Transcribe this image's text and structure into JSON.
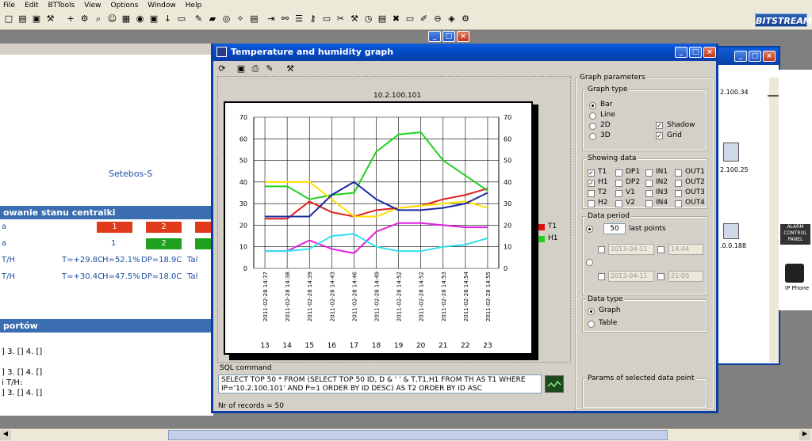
{
  "menu": [
    "File",
    "Edit",
    "BTTools",
    "View",
    "Options",
    "Window",
    "Help"
  ],
  "brand": "BITSTREAM",
  "toolbar_icons": [
    "new-icon",
    "open-icon",
    "save-icon",
    "tools-icon",
    "add-icon",
    "binoculars-icon",
    "search-icon",
    "people-icon",
    "table-icon",
    "chart-icon",
    "floppy-icon",
    "arrow-icon",
    "note-icon",
    "pencil-icon",
    "folder-icon",
    "globe-icon",
    "star-icon",
    "calc-icon",
    "exit-icon",
    "network-icon",
    "book-icon",
    "key-icon",
    "folder2-icon",
    "scissors-icon",
    "wrench-icon",
    "clock-icon",
    "list-icon",
    "x-icon",
    "card-icon",
    "pen-icon",
    "stop-icon",
    "warning-icon",
    "gear-icon"
  ],
  "background": {
    "device_name": "Setebos-S",
    "section1": "owanie stanu centralki",
    "row1": {
      "label": "a",
      "v1": "1",
      "v2": "2"
    },
    "row2": {
      "label": "a",
      "v1": "1",
      "v2": "2"
    },
    "row3": {
      "label": "T/H",
      "t": "T=+29.8C",
      "h": "H=52.1%",
      "dp": "DP=18.9C",
      "x": "Tal"
    },
    "row4": {
      "label": "T/H",
      "t": "T=+30.4C",
      "h": "H=47.5%",
      "dp": "DP=18.0C",
      "x": "Tal"
    },
    "section2": "portów",
    "line1": "] 3. [] 4. []",
    "line2": "] 3. [] 4. []",
    "line3": "i T/H:",
    "line4": "] 3. [] 4. []"
  },
  "right_devices": [
    "2.100.34",
    "2.100.25",
    ".0.0.188",
    "ALARM CONTROL PANEL",
    "IP Phone"
  ],
  "graph_window": {
    "title": "Temperature and humidity graph",
    "chart_title": "10.2.100.101",
    "sql_label": "SQL command",
    "sql": "SELECT TOP 50 * FROM (SELECT TOP 50 ID, D & ' ' & T,T1,H1 FROM TH AS T1 WHERE IP='10.2.100.101' AND P=1 ORDER BY ID DESC) AS T2 ORDER BY ID ASC",
    "records": "Nr of records = 50",
    "params": {
      "title": "Graph parameters",
      "graph_type": "Graph type",
      "bar": "Bar",
      "line": "Line",
      "d2": "2D",
      "d3": "3D",
      "shadow": "Shadow",
      "grid": "Grid",
      "showing": "Showing data",
      "checks": [
        [
          "T1",
          "DP1",
          "IN1",
          "OUT1"
        ],
        [
          "H1",
          "DP2",
          "IN2",
          "OUT2"
        ],
        [
          "T2",
          "V1",
          "IN3",
          "OUT3"
        ],
        [
          "H2",
          "V2",
          "IN4",
          "OUT4"
        ]
      ],
      "period": "Data period",
      "points_value": "50",
      "points_label": "last points",
      "date1": "2013-04-11",
      "time1": "14:44",
      "date2": "2013-04-11",
      "time2": "21:00",
      "data_type": "Data type",
      "graph": "Graph",
      "table": "Table",
      "selected": "Params of selected data point"
    }
  },
  "chart_data": {
    "type": "line",
    "title": "10.2.100.101",
    "x": [
      "2011-02-28 14:37",
      "2011-02-28 14:38",
      "2011-02-28 14:39",
      "2011-02-28 14:43",
      "2011-02-28 14:46",
      "2011-02-28 14:49",
      "2011-02-28 14:52",
      "2011-02-28 14:52",
      "2011-02-28 14:53",
      "2011-02-28 14:54",
      "2011-02-28 14:55"
    ],
    "indices": [
      13,
      14,
      15,
      16,
      17,
      18,
      19,
      20,
      21,
      22,
      23
    ],
    "ylim": [
      0,
      70
    ],
    "yticks": [
      0,
      10,
      20,
      30,
      40,
      50,
      60,
      70
    ],
    "grid": true,
    "legend": [
      {
        "name": "T1",
        "color": "#e01010"
      },
      {
        "name": "H1",
        "color": "#20d020"
      }
    ],
    "series": [
      {
        "color": "#e02020",
        "values": [
          23,
          23,
          31,
          26,
          24,
          27,
          28,
          29,
          32,
          34,
          37
        ]
      },
      {
        "color": "#20d020",
        "values": [
          38,
          38,
          32,
          34,
          35,
          54,
          62,
          63,
          50,
          43,
          36
        ]
      },
      {
        "color": "#ffe000",
        "values": [
          40,
          40,
          40,
          32,
          24,
          24,
          28,
          29,
          30,
          31,
          28
        ]
      },
      {
        "color": "#1a2aa0",
        "values": [
          24,
          24,
          24,
          34,
          40,
          32,
          27,
          27,
          28,
          30,
          35
        ]
      },
      {
        "color": "#e020e0",
        "values": [
          8,
          8,
          13,
          9,
          7,
          17,
          21,
          21,
          20,
          19,
          19
        ]
      },
      {
        "color": "#30e0f0",
        "values": [
          8,
          8,
          9,
          15,
          16,
          10,
          8,
          8,
          10,
          11,
          14
        ]
      }
    ]
  }
}
